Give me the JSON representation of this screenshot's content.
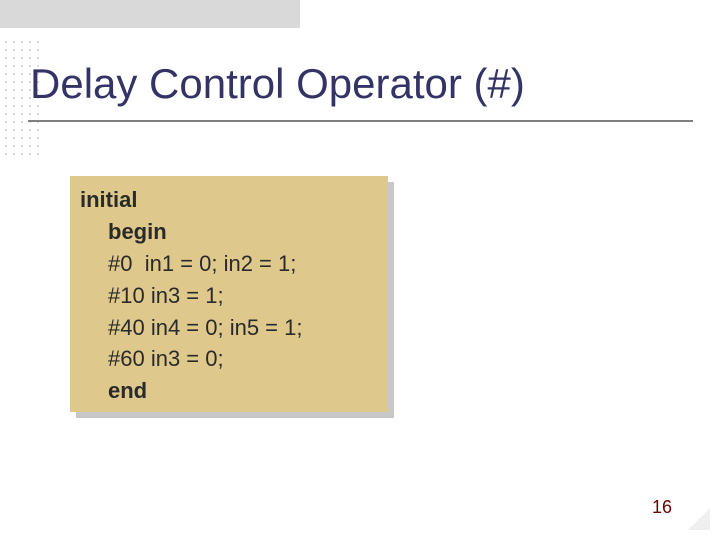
{
  "title": "Delay Control Operator (#)",
  "code": {
    "l1": "initial",
    "l2": "begin",
    "l3": "#0  in1 = 0; in2 = 1;",
    "l4": "#10 in3 = 1;",
    "l5": "#40 in4 = 0; in5 = 1;",
    "l6": "#60 in3 = 0;",
    "l7": "end"
  },
  "page_number": "16"
}
